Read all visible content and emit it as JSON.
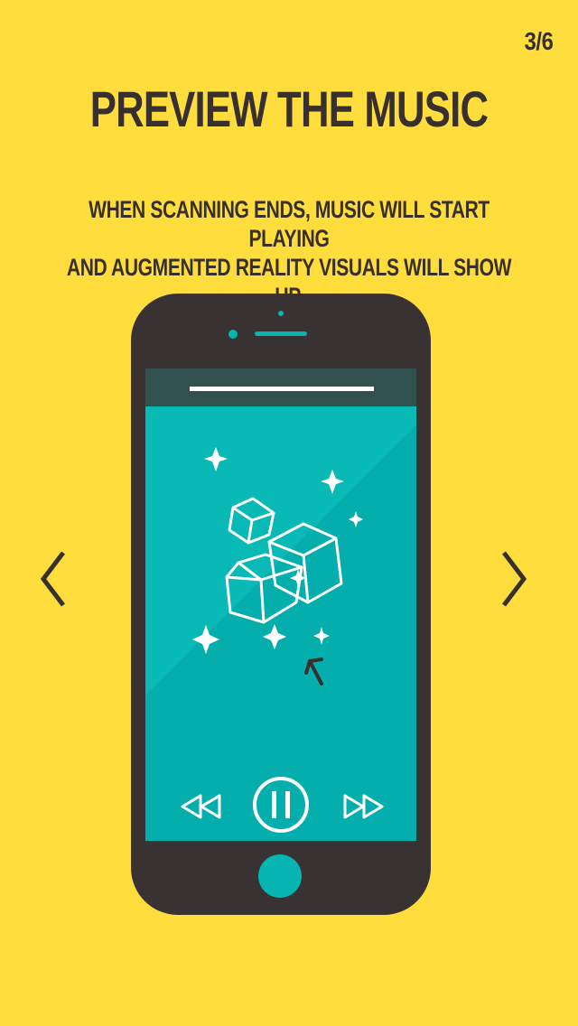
{
  "page_counter": "3/6",
  "title": "PREVIEW THE MUSIC",
  "subtitle_line1": "WHEN SCANNING ENDS, MUSIC WILL START PLAYING",
  "subtitle_line2": "AND AUGMENTED REALITY VISUALS WILL SHOW UP.",
  "icons": {
    "prev": "chevron-left-icon",
    "next": "chevron-right-icon",
    "rewind": "rewind-icon",
    "pause": "pause-icon",
    "fast_forward": "fast-forward-icon",
    "home": "home-button",
    "cursor": "cursor-arrow-icon"
  },
  "colors": {
    "background": "#FFDD3C",
    "text": "#37302F",
    "phone_body": "#383232",
    "screen": "#04B0AE",
    "accent": "#06B4B2",
    "header_bar": "#32504E"
  }
}
